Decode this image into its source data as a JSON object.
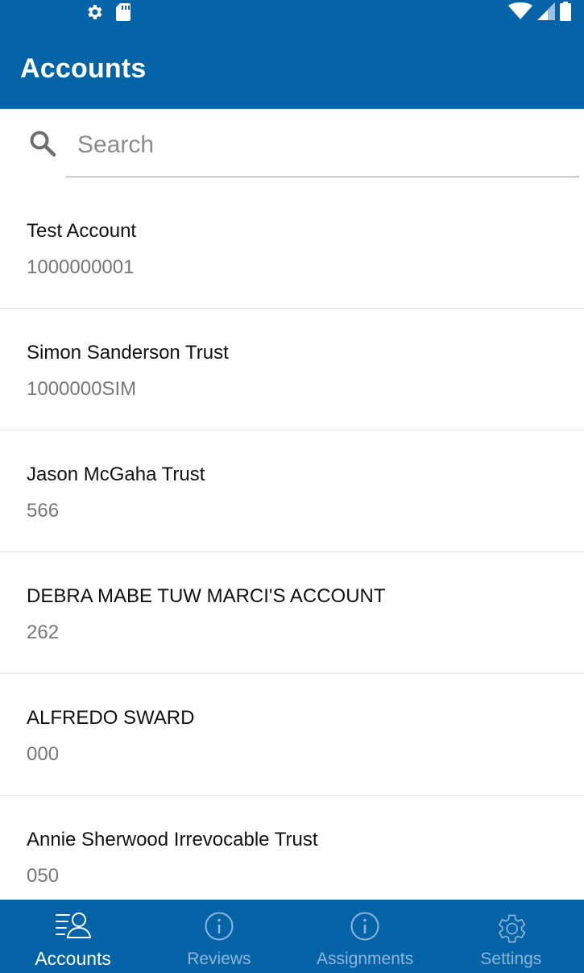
{
  "status_bar": {
    "left_icons": [
      "gear-icon",
      "sd-card-icon"
    ],
    "right_icons": [
      "wifi-icon",
      "signal-icon",
      "battery-icon"
    ]
  },
  "app_bar": {
    "title": "Accounts"
  },
  "search": {
    "placeholder": "Search",
    "value": ""
  },
  "accounts": [
    {
      "name": "Test Account",
      "number": "1000000001"
    },
    {
      "name": "Simon Sanderson Trust",
      "number": "1000000SIM"
    },
    {
      "name": "Jason McGaha Trust",
      "number": "566"
    },
    {
      "name": "DEBRA MABE TUW MARCI'S ACCOUNT",
      "number": "262"
    },
    {
      "name": "ALFREDO SWARD",
      "number": "000"
    },
    {
      "name": "Annie Sherwood Irrevocable Trust",
      "number": "050"
    }
  ],
  "bottom_nav": {
    "tabs": [
      {
        "label": "Accounts",
        "icon": "accounts-icon",
        "active": true
      },
      {
        "label": "Reviews",
        "icon": "info-icon",
        "active": false
      },
      {
        "label": "Assignments",
        "icon": "info-icon",
        "active": false
      },
      {
        "label": "Settings",
        "icon": "gear-icon",
        "active": false
      }
    ]
  },
  "colors": {
    "primary": "#0563a8",
    "inactive_tab": "#8fb6d8",
    "secondary_text": "#777777"
  }
}
